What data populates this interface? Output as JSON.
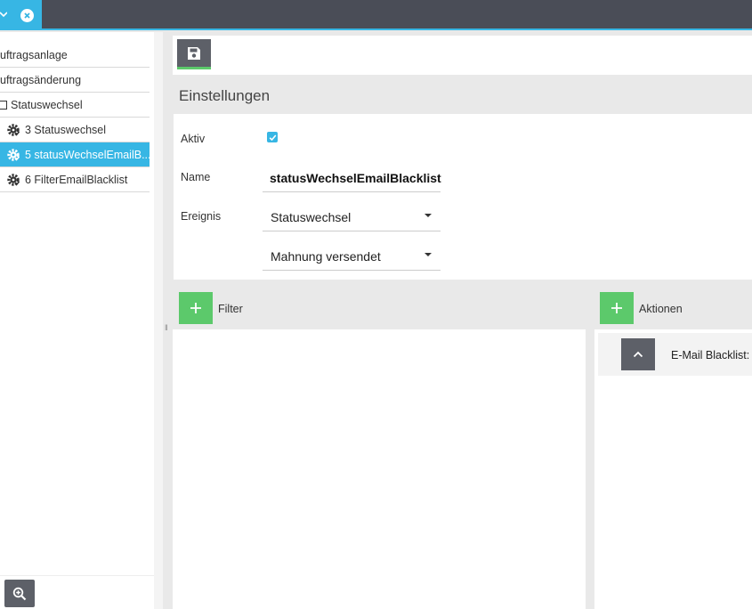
{
  "topbar": {
    "close_icon": "close-circle-icon",
    "chevron_icon": "chevron-down-icon"
  },
  "sidebar": {
    "items": [
      {
        "label": "uftragsanlage"
      },
      {
        "label": "uftragsänderung"
      },
      {
        "label": "Statuswechsel"
      },
      {
        "label": "3 Statuswechsel"
      },
      {
        "label": "5 statusWechselEmailB..."
      },
      {
        "label": "6 FilterEmailBlacklist"
      }
    ],
    "zoom_icon": "zoom-in-icon"
  },
  "toolbar": {
    "save_icon": "floppy-disk-icon"
  },
  "settings": {
    "title": "Einstellungen",
    "aktiv_label": "Aktiv",
    "aktiv_checked": true,
    "name_label": "Name",
    "name_value": "statusWechselEmailBlacklist",
    "ereignis_label": "Ereignis",
    "ereignis_value": "Statuswechsel",
    "ereignis_sub_value": "Mahnung versendet"
  },
  "filter": {
    "title": "Filter",
    "add_icon": "plus-icon"
  },
  "aktionen": {
    "title": "Aktionen",
    "add_icon": "plus-icon",
    "items": [
      {
        "label": "E-Mail Blacklist: D"
      }
    ]
  },
  "colors": {
    "accent": "#37b6e4",
    "green": "#5cc96b",
    "dark": "#4a4d57"
  }
}
